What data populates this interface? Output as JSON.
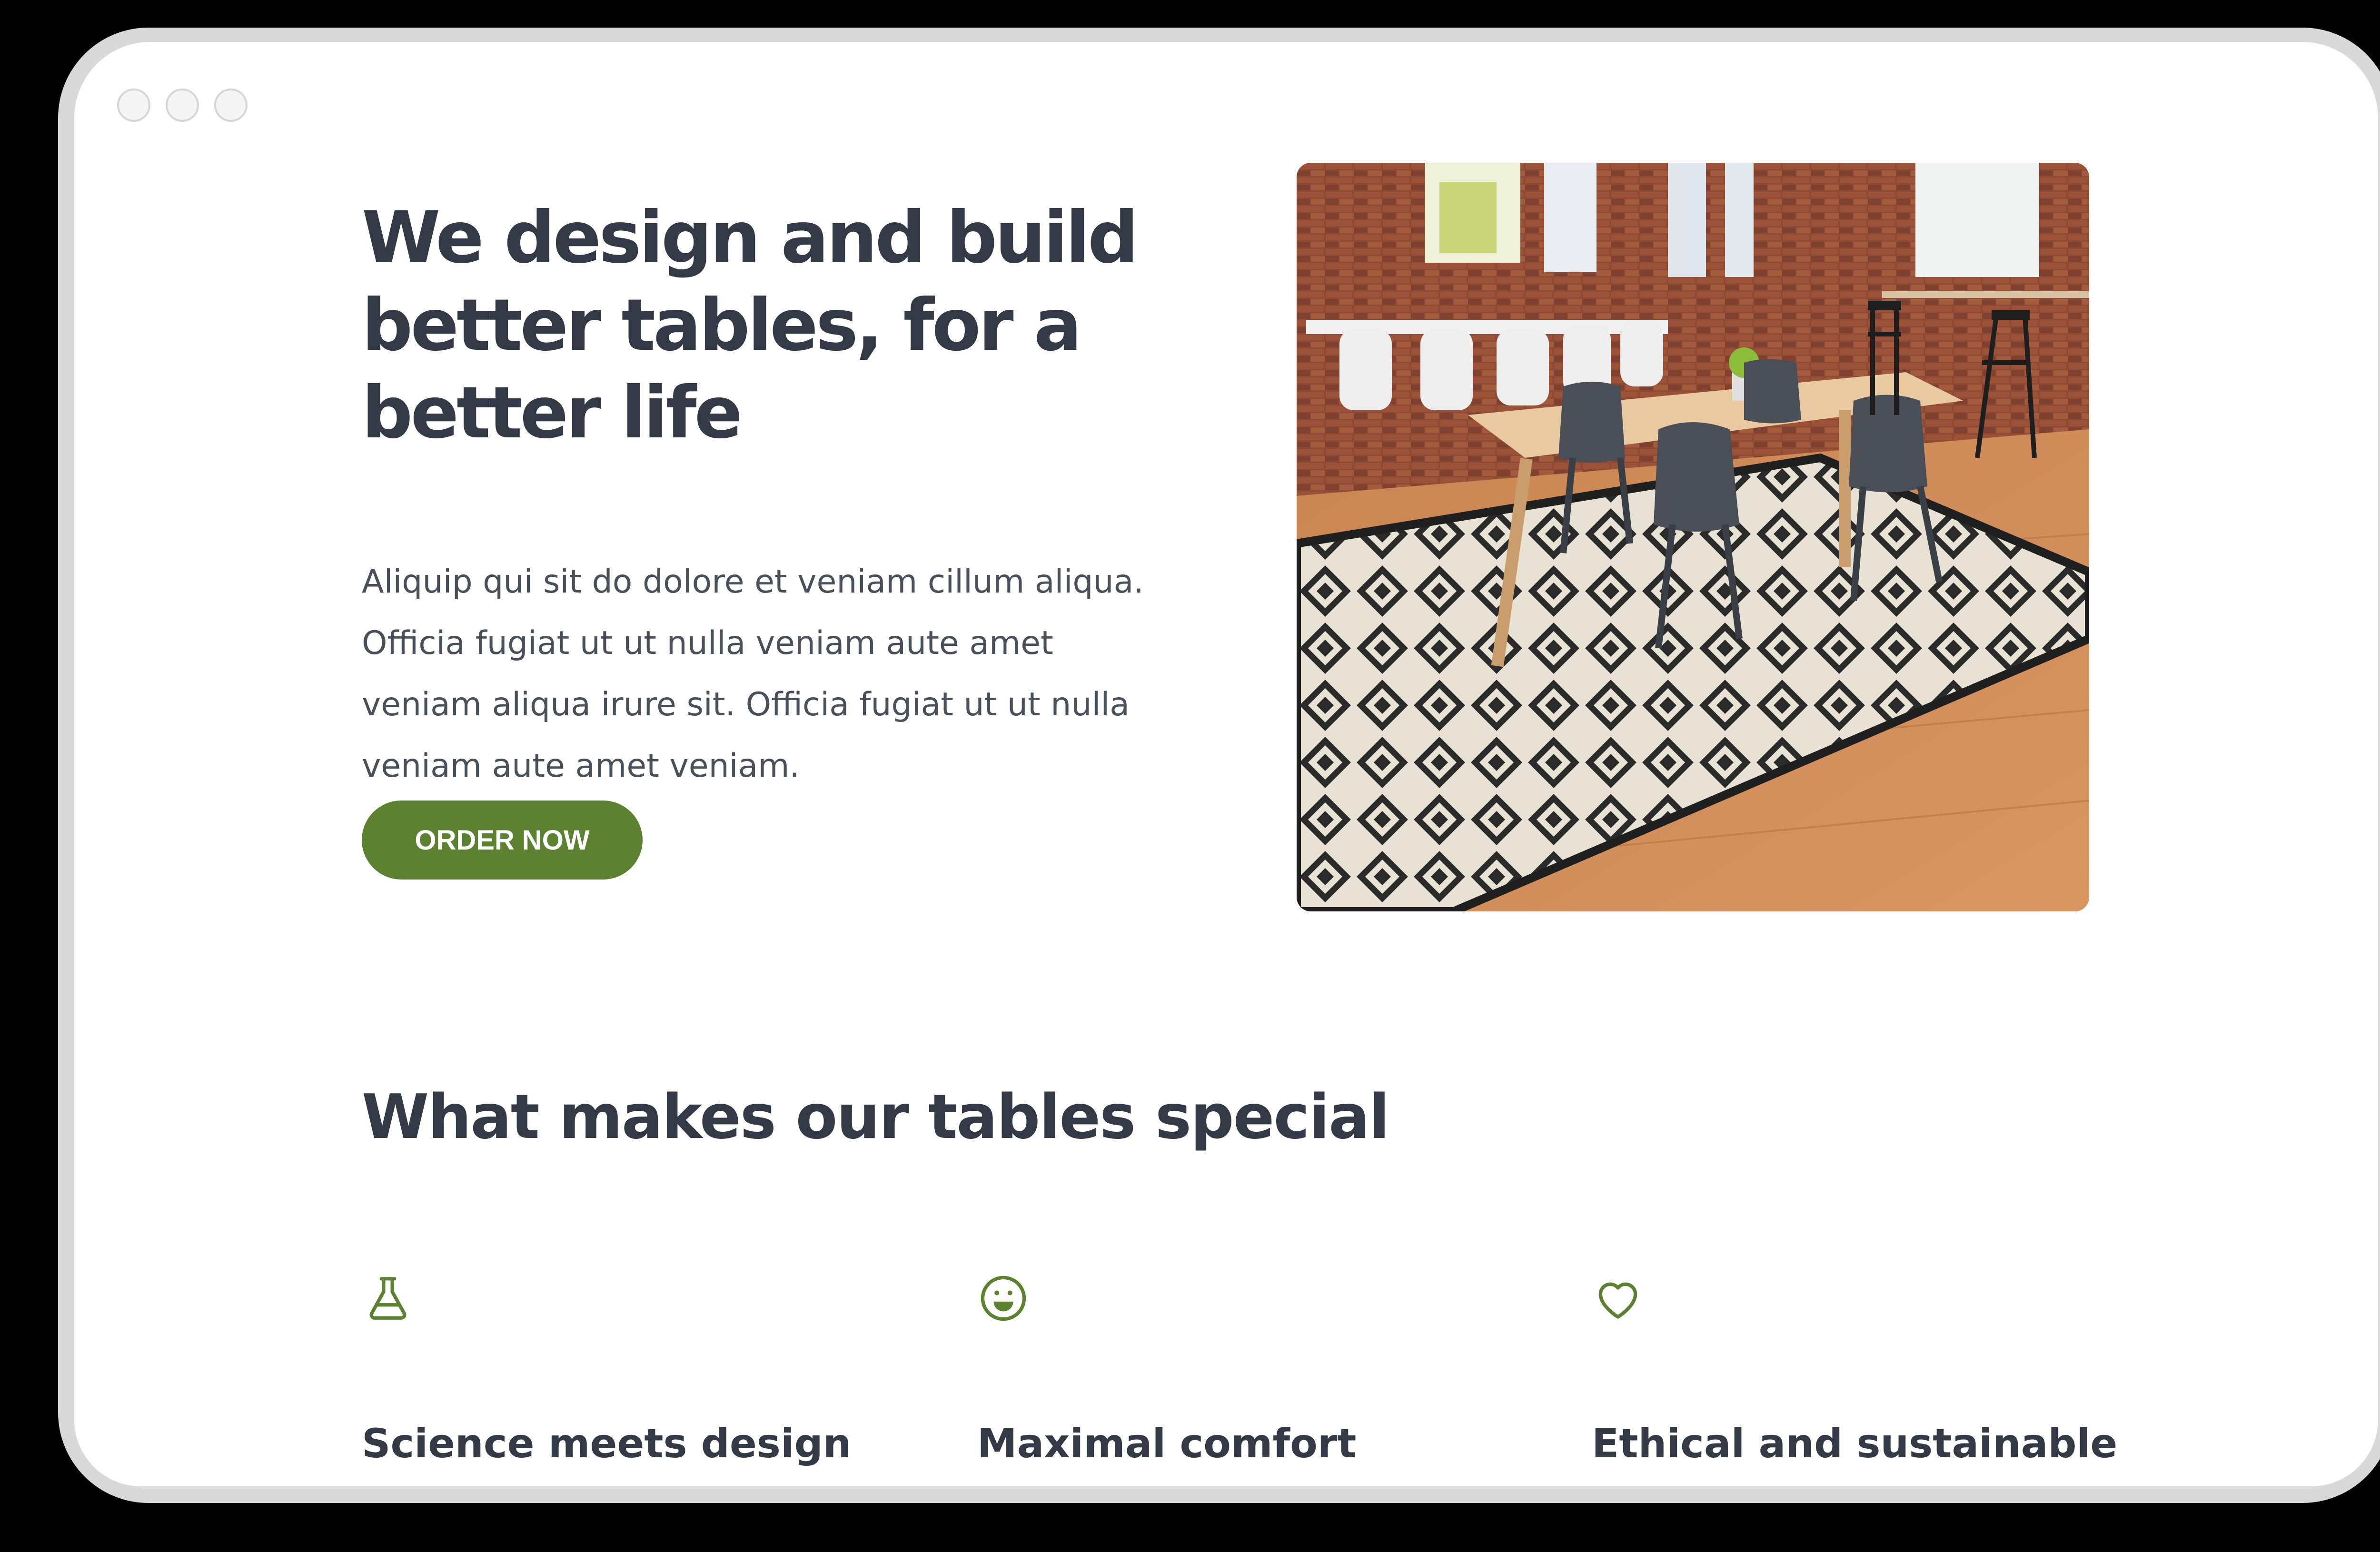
{
  "hero": {
    "title": "We design and build better tables, for a better life",
    "text": "Aliquip qui sit do dolore et veniam cillum aliqua. Officia fugiat ut ut nulla veniam aute amet veniam aliqua irure sit. Officia fugiat ut ut nulla veniam aute amet veniam.",
    "cta_label": "ORDER NOW"
  },
  "features": {
    "title": "What makes our tables special",
    "items": [
      {
        "icon": "flask-icon",
        "title": "Science meets design"
      },
      {
        "icon": "smiley-icon",
        "title": "Maximal comfort"
      },
      {
        "icon": "heart-icon",
        "title": "Ethical and sustainable"
      }
    ]
  },
  "colors": {
    "accent": "#5b8131",
    "heading": "#333a45",
    "body": "#4a5059",
    "background": "#ffffff",
    "backdrop": "#000000"
  }
}
